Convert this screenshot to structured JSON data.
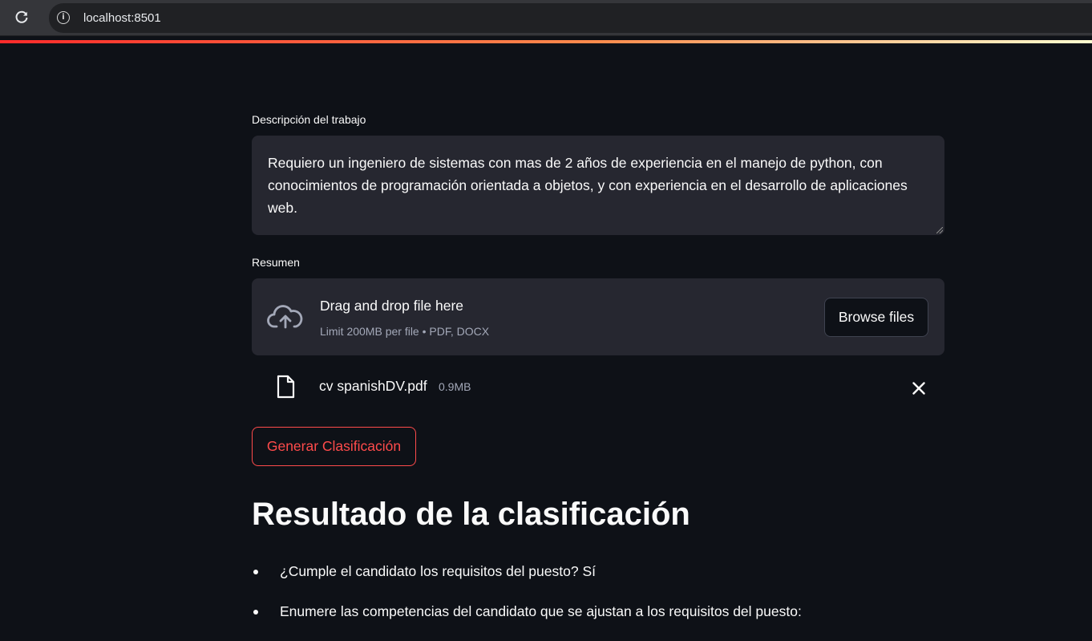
{
  "browser": {
    "url": "localhost:8501"
  },
  "form": {
    "job_description_label": "Descripción del trabajo",
    "job_description_value": "Requiero un ingeniero de sistemas con mas de 2 años de experiencia en el manejo de python, con conocimientos de programación orientada a objetos, y con experiencia en el desarrollo de aplicaciones web.",
    "resume_label": "Resumen",
    "uploader": {
      "title": "Drag and drop file here",
      "subtitle": "Limit 200MB per file • PDF, DOCX",
      "browse_label": "Browse files"
    },
    "uploaded_file": {
      "name": "cv spanishDV.pdf",
      "size": "0.9MB"
    },
    "generate_label": "Generar Clasificación"
  },
  "result": {
    "heading": "Resultado de la clasificación",
    "items": [
      "¿Cumple el candidato los requisitos del puesto? Sí",
      "Enumere las competencias del candidato que se ajustan a los requisitos del puesto:"
    ]
  },
  "colors": {
    "background": "#0e1117",
    "widget_bg": "#262730",
    "accent": "#ff4b4b",
    "text": "#fafafa",
    "muted": "#a3a8b8"
  }
}
